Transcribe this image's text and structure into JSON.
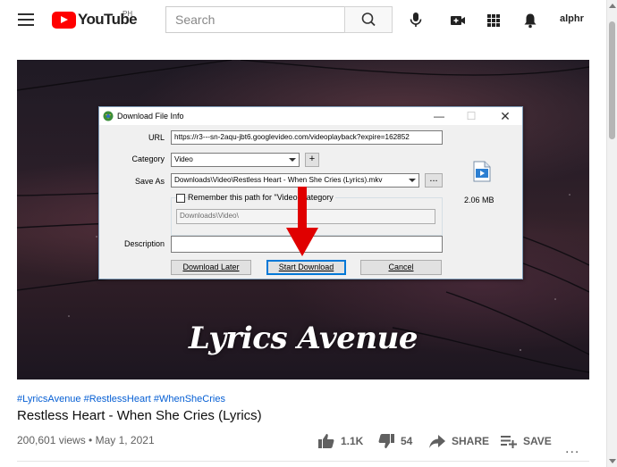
{
  "youtube": {
    "logo_text": "YouTube",
    "country": "PH",
    "search_placeholder": "Search",
    "user_label": "alphr"
  },
  "video": {
    "overlay_title": "Lyrics Avenue"
  },
  "dialog": {
    "title": "Download File Info",
    "url_label": "URL",
    "url_value": "https://r3---sn-2aqu-jbt6.googlevideo.com/videoplayback?expire=162852",
    "category_label": "Category",
    "category_value": "Video",
    "add_label": "+",
    "save_as_label": "Save As",
    "save_as_value": "Downloads\\Video\\Restless Heart - When She Cries (Lyrics).mkv",
    "browse_label": "...",
    "remember_label": "Remember this path for \"Video\" category",
    "remember_path": "Downloads\\Video\\",
    "description_label": "Description",
    "description_value": "",
    "file_size": "2.06  MB",
    "download_later": "Download Later",
    "start_download": "Start Download",
    "cancel": "Cancel"
  },
  "meta": {
    "hashtags": "#LyricsAvenue #RestlessHeart #WhenSheCries",
    "title": "Restless Heart - When She Cries (Lyrics)",
    "views_date": "200,601 views • May 1, 2021",
    "likes": "1.1K",
    "dislikes": "54",
    "share": "SHARE",
    "save": "SAVE",
    "more": "..."
  },
  "colors": {
    "accent": "#065fd4",
    "youtube_red": "#ff0000",
    "arrow_red": "#e00000"
  }
}
